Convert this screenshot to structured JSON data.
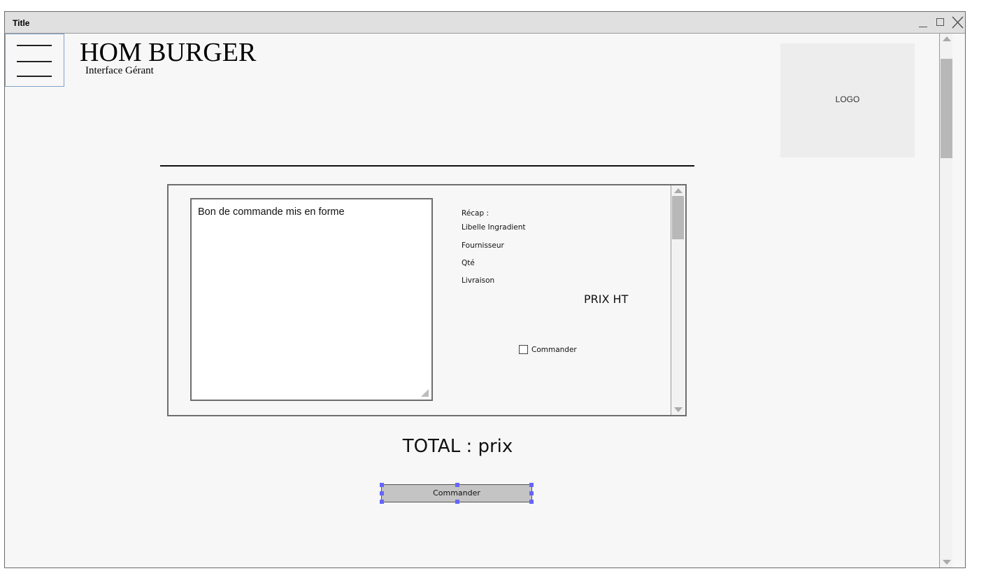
{
  "window": {
    "title": "Title"
  },
  "header": {
    "brand_title": "HOM BURGER",
    "brand_subtitle": "Interface Gérant",
    "logo_label": "LOGO"
  },
  "order_panel": {
    "text_area_label": "Bon de commande mis en forme",
    "recap_title": "Récap :",
    "recap_items": [
      "Libelle Ingradient",
      "Fournisseur",
      "Qté",
      "Livraison"
    ],
    "price_label": "PRIX HT",
    "checkbox_label": "Commander",
    "checkbox_checked": false
  },
  "total_label": "TOTAL : prix",
  "commander_button_label": "Commander",
  "colors": {
    "background": "#f7f7f7",
    "titlebar": "#e0e0e0",
    "logo_box": "#ededed",
    "button": "#c4c4c4",
    "selection_handle": "#6666ff"
  },
  "icons": [
    "menu-icon",
    "minimize-icon",
    "maximize-icon",
    "close-icon"
  ]
}
